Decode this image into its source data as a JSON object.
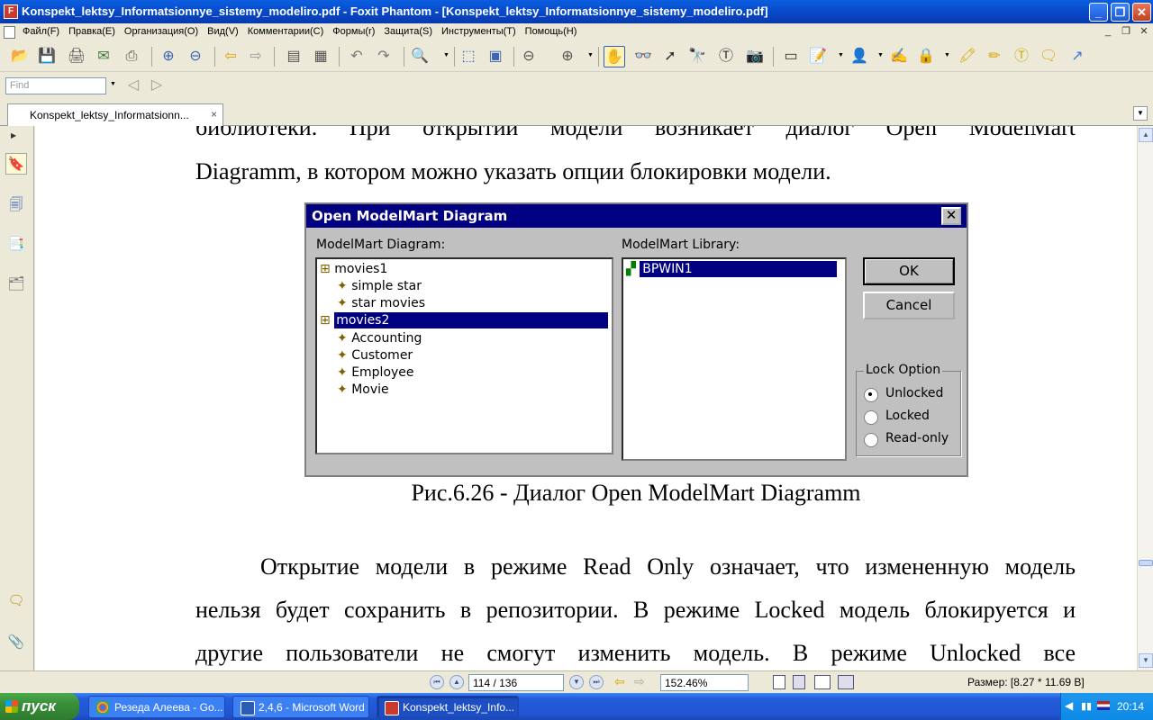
{
  "window": {
    "title": "Konspekt_lektsy_Informatsionnye_sistemy_modeliro.pdf - Foxit Phantom - [Konspekt_lektsy_Informatsionnye_sistemy_modeliro.pdf]",
    "controls": {
      "minimize": "_",
      "restore": "❐",
      "close": "✕"
    }
  },
  "menu": {
    "items": [
      "Файл(F)",
      "Правка(E)",
      "Организация(O)",
      "Вид(V)",
      "Комментарии(C)",
      "Формы(r)",
      "Защита(S)",
      "Инструменты(T)",
      "Помощь(H)"
    ]
  },
  "find": {
    "placeholder": "Find"
  },
  "tab": {
    "label": "Konspekt_lektsy_Informatsionn...",
    "close": "×"
  },
  "document": {
    "line1": "библиотеки. При открытии модели возникает диалог Open ModelMart",
    "line2": "Diagramm, в котором можно указать опции блокировки модели.",
    "caption": "Рис.6.26 - Диалог Open ModelMart Diagramm",
    "para1_line1": "Открытие модели в режиме Read Only означает, что измененную модель",
    "para1_line2": "нельзя будет сохранить в репозитории. В режиме Locked модель блокируется и",
    "para1_line3": "другие пользователи не смогут изменить модель. В режиме Unlocked все"
  },
  "dialog": {
    "title": "Open ModelMart Diagram",
    "close": "✕",
    "diagram_label": "ModelMart Diagram:",
    "library_label": "ModelMart Library:",
    "tree": [
      {
        "label": "movies1",
        "level": 0
      },
      {
        "label": "simple star",
        "level": 1
      },
      {
        "label": "star movies",
        "level": 1
      },
      {
        "label": "movies2",
        "level": 0,
        "selected": true
      },
      {
        "label": "Accounting",
        "level": 1
      },
      {
        "label": "Customer",
        "level": 1
      },
      {
        "label": "Employee",
        "level": 1
      },
      {
        "label": "Movie",
        "level": 1
      }
    ],
    "library_item": "BPWIN1",
    "ok": "OK",
    "cancel": "Cancel",
    "lock_title": "Lock Option",
    "lock_options": [
      "Unlocked",
      "Locked",
      "Read-only"
    ],
    "lock_selected": "Unlocked"
  },
  "status": {
    "page": "114 / 136",
    "zoom": "152.46%",
    "size": "Размер: [8.27 * 11.69 B]"
  },
  "taskbar": {
    "start": "пуск",
    "tasks": [
      "Резеда Алеева - Go...",
      "2,4,6 - Microsoft Word",
      "Konspekt_lektsy_Info..."
    ],
    "clock": "20:14"
  },
  "colors": {
    "titlebar": "#0846C4",
    "dialog_title": "#000080",
    "selection": "#000080",
    "taskbar": "#245DDB",
    "start": "#3A8F3A"
  }
}
